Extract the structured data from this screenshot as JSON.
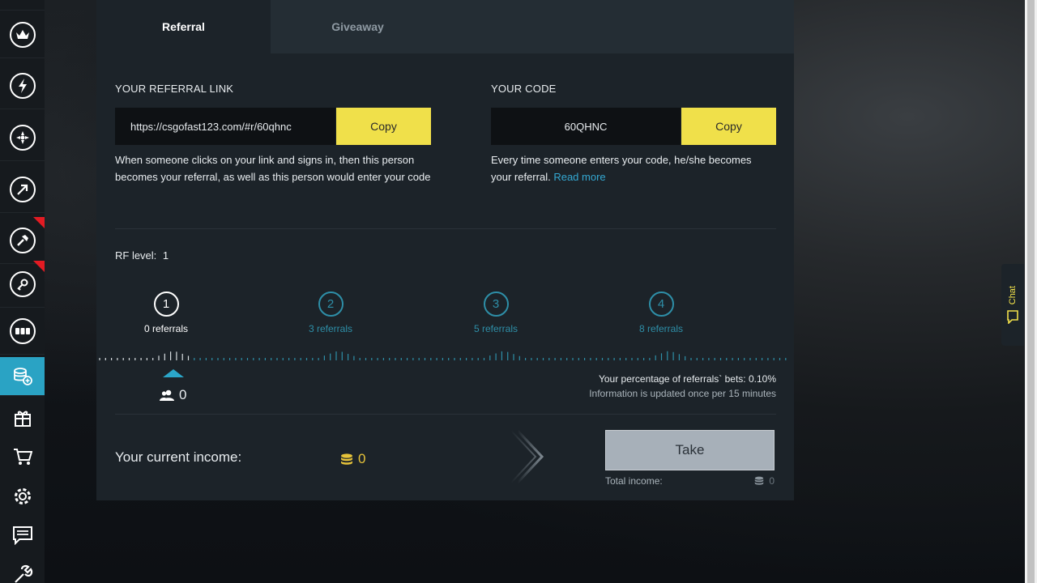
{
  "tabs": [
    {
      "label": "Referral",
      "active": true
    },
    {
      "label": "Giveaway",
      "active": false
    }
  ],
  "referral_link": {
    "heading": "YOUR REFERRAL LINK",
    "value": "https://csgofast123.com/#r/60qhnc",
    "copy_label": "Copy",
    "description": "When someone clicks on your link and signs in, then this person becomes your referral, as well as this person would enter your code"
  },
  "code": {
    "heading": "YOUR CODE",
    "value": "60QHNC",
    "copy_label": "Copy",
    "description": "Every time someone enters your code, he/she becomes your referral.",
    "read_more": "Read more"
  },
  "rf_level": {
    "label": "RF level:",
    "value": "1"
  },
  "levels": [
    {
      "num": "1",
      "caption": "0 referrals",
      "active": true
    },
    {
      "num": "2",
      "caption": "3 referrals",
      "active": false
    },
    {
      "num": "3",
      "caption": "5 referrals",
      "active": false
    },
    {
      "num": "4",
      "caption": "8 referrals",
      "active": false
    }
  ],
  "referral_count": "0",
  "percentage_text": "Your percentage of referrals` bets: 0.10%",
  "update_text": "Information is updated once per 15 minutes",
  "income": {
    "label": "Your current income:",
    "value": "0",
    "take_label": "Take",
    "total_label": "Total income:",
    "total_value": "0"
  },
  "chat": {
    "label": "Chat"
  },
  "sidebar_icons": [
    "crown-icon",
    "lightning-icon",
    "fan-icon",
    "arrow-icon",
    "hammer-icon",
    "key-icon",
    "dots-icon",
    "coins-add-icon",
    "gift-icon",
    "cart-icon",
    "gear-icon",
    "chat-list-icon",
    "wrench-icon"
  ],
  "colors": {
    "accent": "#2aa3c4",
    "copy": "#f0e04a",
    "coin": "#e6c33a",
    "badge": "#e31b23"
  }
}
